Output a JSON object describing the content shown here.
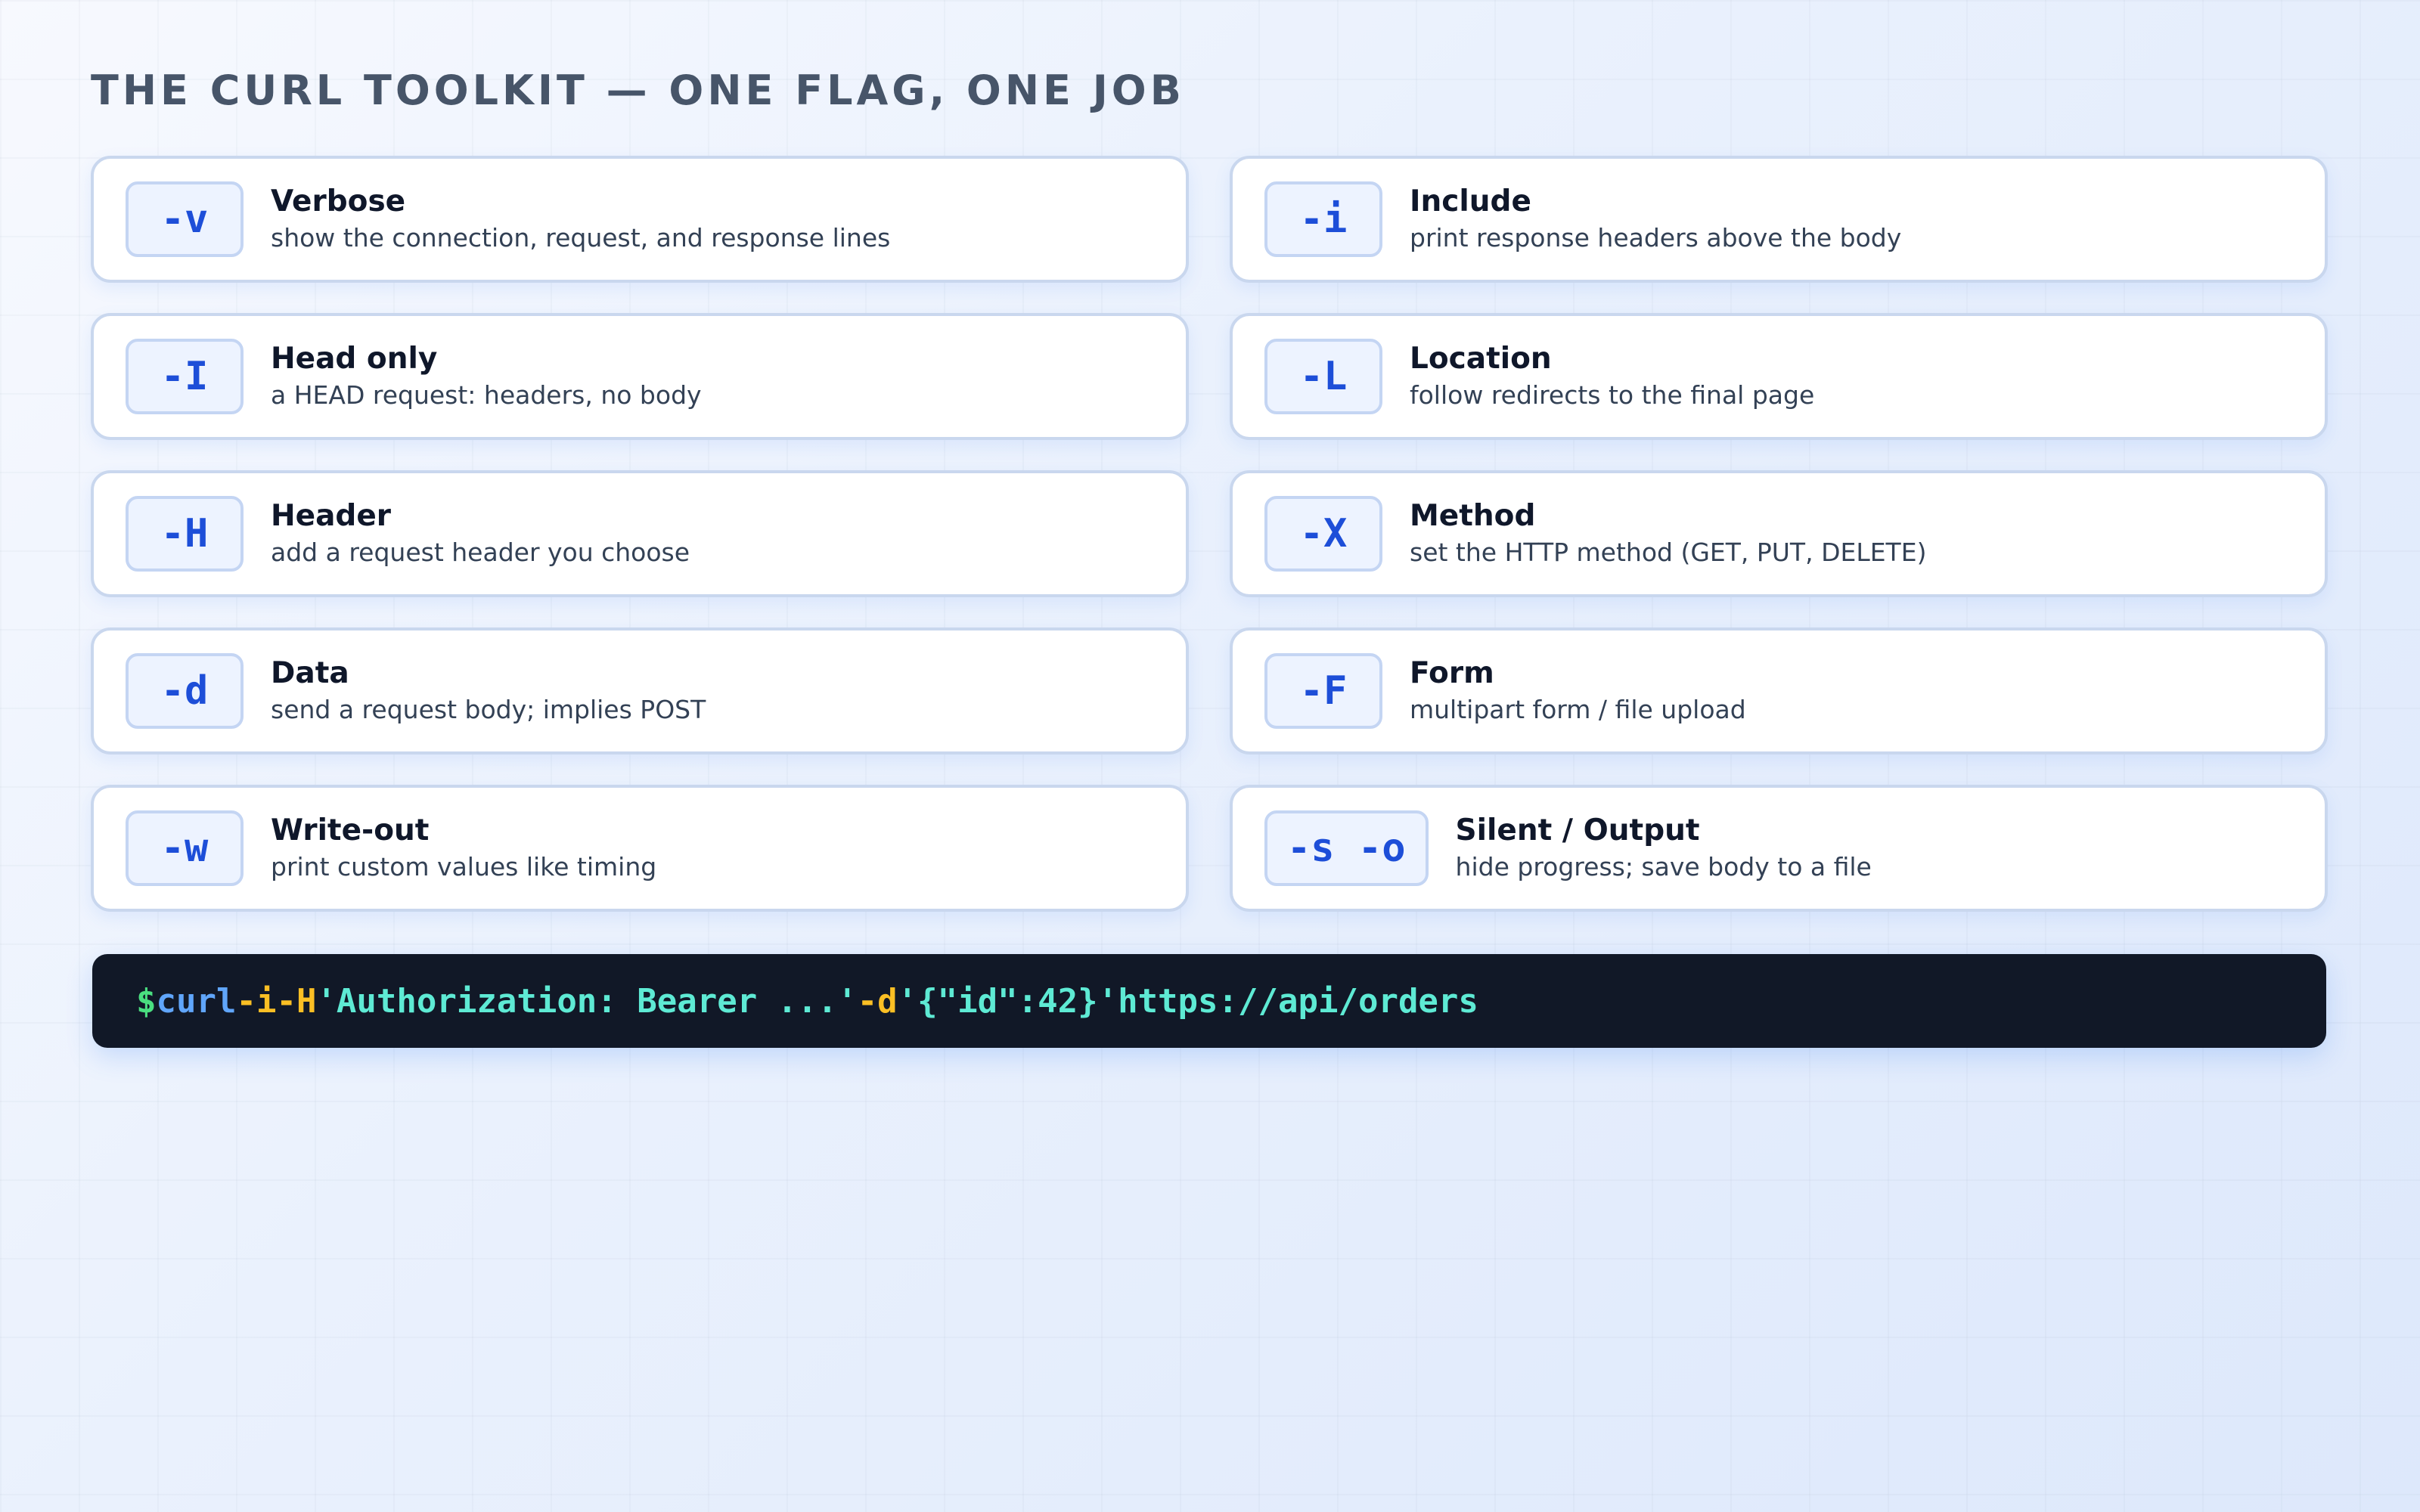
{
  "title": "THE CURL TOOLKIT — ONE FLAG, ONE JOB",
  "flags": [
    {
      "flag": "-v",
      "name": "Verbose",
      "desc": "show the connection, request, and response lines"
    },
    {
      "flag": "-i",
      "name": "Include",
      "desc": "print response headers above the body"
    },
    {
      "flag": "-I",
      "name": "Head only",
      "desc": "a HEAD request: headers, no body"
    },
    {
      "flag": "-L",
      "name": "Location",
      "desc": "follow redirects to the final page"
    },
    {
      "flag": "-H",
      "name": "Header",
      "desc": "add a request header you choose"
    },
    {
      "flag": "-X",
      "name": "Method",
      "desc": "set the HTTP method (GET, PUT, DELETE)"
    },
    {
      "flag": "-d",
      "name": "Data",
      "desc": "send a request body; implies POST"
    },
    {
      "flag": "-F",
      "name": "Form",
      "desc": "multipart form / file upload"
    },
    {
      "flag": "-w",
      "name": "Write-out",
      "desc": "print custom values like timing"
    },
    {
      "flag": "-s -o",
      "name": "Silent / Output",
      "desc": "hide progress; save body to a file"
    }
  ],
  "command": {
    "tokens": [
      {
        "text": "$",
        "color": "#4ade80"
      },
      {
        "text": "curl",
        "color": "#60a5fa"
      },
      {
        "text": "-i",
        "color": "#fbbf24"
      },
      {
        "text": "-H",
        "color": "#fbbf24"
      },
      {
        "text": "'Authorization: Bearer ...'",
        "color": "#5eead4"
      },
      {
        "text": "-d",
        "color": "#fbbf24"
      },
      {
        "text": "'{\"id\":42}'",
        "color": "#5eead4"
      },
      {
        "text": "https://api/orders",
        "color": "#5eead4"
      }
    ]
  }
}
